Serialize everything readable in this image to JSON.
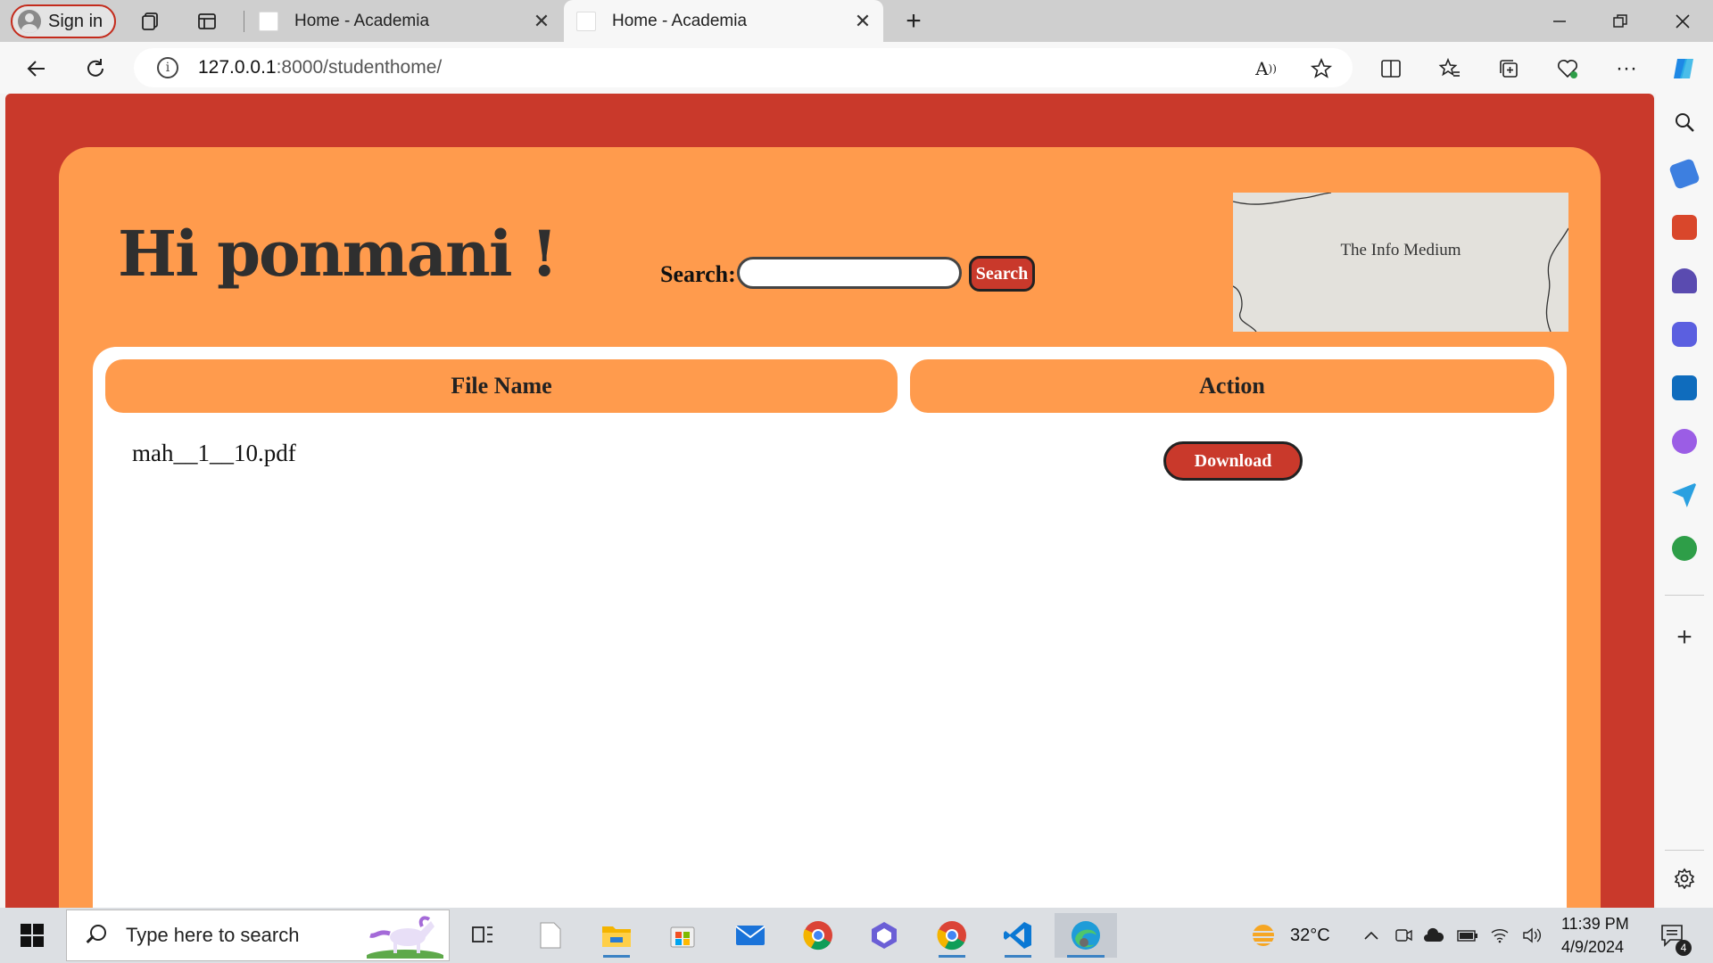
{
  "browser": {
    "sign_in": "Sign in",
    "tabs": [
      {
        "title": "Home - Academia"
      },
      {
        "title": "Home - Academia"
      }
    ],
    "url_host": "127.0.0.1",
    "url_path": ":8000/studenthome/"
  },
  "page": {
    "greeting": "Hi ponmani !",
    "search_label": "Search:",
    "search_value": "",
    "search_button": "Search",
    "logo_text": "The Info Medium",
    "table": {
      "headers": [
        "File Name",
        "Action"
      ],
      "rows": [
        {
          "file_name": "mah__1__10.pdf",
          "action": "Download"
        }
      ]
    }
  },
  "taskbar": {
    "search_placeholder": "Type here to search",
    "weather": "32°C",
    "time": "11:39 PM",
    "date": "4/9/2024",
    "notification_count": "4"
  },
  "colors": {
    "page_background": "#c9392b",
    "card_background": "#ff9b4d",
    "button_background": "#c9392b"
  }
}
